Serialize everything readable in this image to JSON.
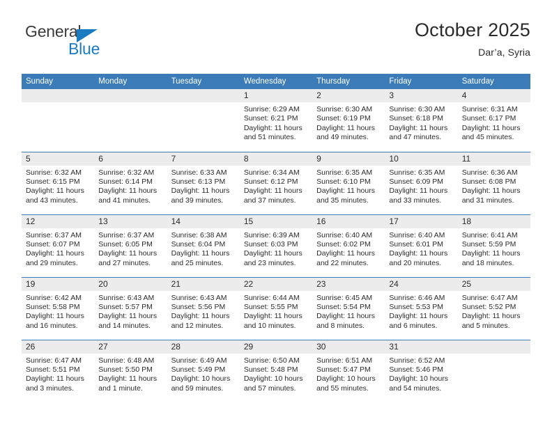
{
  "brand": {
    "name_top": "General",
    "name_bottom": "Blue"
  },
  "header": {
    "title": "October 2025",
    "location": "Dar’a, Syria"
  },
  "weekday_headers": [
    "Sunday",
    "Monday",
    "Tuesday",
    "Wednesday",
    "Thursday",
    "Friday",
    "Saturday"
  ],
  "labels": {
    "sunrise_prefix": "Sunrise: ",
    "sunset_prefix": "Sunset: ",
    "daylight_prefix": "Daylight: "
  },
  "colors": {
    "header_blue": "#3b7cb8",
    "daynum_gray": "#ececec",
    "brand_blue": "#1b7bc0",
    "text": "#2b2b2b"
  },
  "weeks": [
    [
      {
        "day": "",
        "empty": true
      },
      {
        "day": "",
        "empty": true
      },
      {
        "day": "",
        "empty": true
      },
      {
        "day": "1",
        "sunrise": "Sunrise: 6:29 AM",
        "sunset": "Sunset: 6:21 PM",
        "daylight_l1": "Daylight: 11 hours",
        "daylight_l2": "and 51 minutes."
      },
      {
        "day": "2",
        "sunrise": "Sunrise: 6:30 AM",
        "sunset": "Sunset: 6:19 PM",
        "daylight_l1": "Daylight: 11 hours",
        "daylight_l2": "and 49 minutes."
      },
      {
        "day": "3",
        "sunrise": "Sunrise: 6:30 AM",
        "sunset": "Sunset: 6:18 PM",
        "daylight_l1": "Daylight: 11 hours",
        "daylight_l2": "and 47 minutes."
      },
      {
        "day": "4",
        "sunrise": "Sunrise: 6:31 AM",
        "sunset": "Sunset: 6:17 PM",
        "daylight_l1": "Daylight: 11 hours",
        "daylight_l2": "and 45 minutes."
      }
    ],
    [
      {
        "day": "5",
        "sunrise": "Sunrise: 6:32 AM",
        "sunset": "Sunset: 6:15 PM",
        "daylight_l1": "Daylight: 11 hours",
        "daylight_l2": "and 43 minutes."
      },
      {
        "day": "6",
        "sunrise": "Sunrise: 6:32 AM",
        "sunset": "Sunset: 6:14 PM",
        "daylight_l1": "Daylight: 11 hours",
        "daylight_l2": "and 41 minutes."
      },
      {
        "day": "7",
        "sunrise": "Sunrise: 6:33 AM",
        "sunset": "Sunset: 6:13 PM",
        "daylight_l1": "Daylight: 11 hours",
        "daylight_l2": "and 39 minutes."
      },
      {
        "day": "8",
        "sunrise": "Sunrise: 6:34 AM",
        "sunset": "Sunset: 6:12 PM",
        "daylight_l1": "Daylight: 11 hours",
        "daylight_l2": "and 37 minutes."
      },
      {
        "day": "9",
        "sunrise": "Sunrise: 6:35 AM",
        "sunset": "Sunset: 6:10 PM",
        "daylight_l1": "Daylight: 11 hours",
        "daylight_l2": "and 35 minutes."
      },
      {
        "day": "10",
        "sunrise": "Sunrise: 6:35 AM",
        "sunset": "Sunset: 6:09 PM",
        "daylight_l1": "Daylight: 11 hours",
        "daylight_l2": "and 33 minutes."
      },
      {
        "day": "11",
        "sunrise": "Sunrise: 6:36 AM",
        "sunset": "Sunset: 6:08 PM",
        "daylight_l1": "Daylight: 11 hours",
        "daylight_l2": "and 31 minutes."
      }
    ],
    [
      {
        "day": "12",
        "sunrise": "Sunrise: 6:37 AM",
        "sunset": "Sunset: 6:07 PM",
        "daylight_l1": "Daylight: 11 hours",
        "daylight_l2": "and 29 minutes."
      },
      {
        "day": "13",
        "sunrise": "Sunrise: 6:37 AM",
        "sunset": "Sunset: 6:05 PM",
        "daylight_l1": "Daylight: 11 hours",
        "daylight_l2": "and 27 minutes."
      },
      {
        "day": "14",
        "sunrise": "Sunrise: 6:38 AM",
        "sunset": "Sunset: 6:04 PM",
        "daylight_l1": "Daylight: 11 hours",
        "daylight_l2": "and 25 minutes."
      },
      {
        "day": "15",
        "sunrise": "Sunrise: 6:39 AM",
        "sunset": "Sunset: 6:03 PM",
        "daylight_l1": "Daylight: 11 hours",
        "daylight_l2": "and 23 minutes."
      },
      {
        "day": "16",
        "sunrise": "Sunrise: 6:40 AM",
        "sunset": "Sunset: 6:02 PM",
        "daylight_l1": "Daylight: 11 hours",
        "daylight_l2": "and 22 minutes."
      },
      {
        "day": "17",
        "sunrise": "Sunrise: 6:40 AM",
        "sunset": "Sunset: 6:01 PM",
        "daylight_l1": "Daylight: 11 hours",
        "daylight_l2": "and 20 minutes."
      },
      {
        "day": "18",
        "sunrise": "Sunrise: 6:41 AM",
        "sunset": "Sunset: 5:59 PM",
        "daylight_l1": "Daylight: 11 hours",
        "daylight_l2": "and 18 minutes."
      }
    ],
    [
      {
        "day": "19",
        "sunrise": "Sunrise: 6:42 AM",
        "sunset": "Sunset: 5:58 PM",
        "daylight_l1": "Daylight: 11 hours",
        "daylight_l2": "and 16 minutes."
      },
      {
        "day": "20",
        "sunrise": "Sunrise: 6:43 AM",
        "sunset": "Sunset: 5:57 PM",
        "daylight_l1": "Daylight: 11 hours",
        "daylight_l2": "and 14 minutes."
      },
      {
        "day": "21",
        "sunrise": "Sunrise: 6:43 AM",
        "sunset": "Sunset: 5:56 PM",
        "daylight_l1": "Daylight: 11 hours",
        "daylight_l2": "and 12 minutes."
      },
      {
        "day": "22",
        "sunrise": "Sunrise: 6:44 AM",
        "sunset": "Sunset: 5:55 PM",
        "daylight_l1": "Daylight: 11 hours",
        "daylight_l2": "and 10 minutes."
      },
      {
        "day": "23",
        "sunrise": "Sunrise: 6:45 AM",
        "sunset": "Sunset: 5:54 PM",
        "daylight_l1": "Daylight: 11 hours",
        "daylight_l2": "and 8 minutes."
      },
      {
        "day": "24",
        "sunrise": "Sunrise: 6:46 AM",
        "sunset": "Sunset: 5:53 PM",
        "daylight_l1": "Daylight: 11 hours",
        "daylight_l2": "and 6 minutes."
      },
      {
        "day": "25",
        "sunrise": "Sunrise: 6:47 AM",
        "sunset": "Sunset: 5:52 PM",
        "daylight_l1": "Daylight: 11 hours",
        "daylight_l2": "and 5 minutes."
      }
    ],
    [
      {
        "day": "26",
        "sunrise": "Sunrise: 6:47 AM",
        "sunset": "Sunset: 5:51 PM",
        "daylight_l1": "Daylight: 11 hours",
        "daylight_l2": "and 3 minutes."
      },
      {
        "day": "27",
        "sunrise": "Sunrise: 6:48 AM",
        "sunset": "Sunset: 5:50 PM",
        "daylight_l1": "Daylight: 11 hours",
        "daylight_l2": "and 1 minute."
      },
      {
        "day": "28",
        "sunrise": "Sunrise: 6:49 AM",
        "sunset": "Sunset: 5:49 PM",
        "daylight_l1": "Daylight: 10 hours",
        "daylight_l2": "and 59 minutes."
      },
      {
        "day": "29",
        "sunrise": "Sunrise: 6:50 AM",
        "sunset": "Sunset: 5:48 PM",
        "daylight_l1": "Daylight: 10 hours",
        "daylight_l2": "and 57 minutes."
      },
      {
        "day": "30",
        "sunrise": "Sunrise: 6:51 AM",
        "sunset": "Sunset: 5:47 PM",
        "daylight_l1": "Daylight: 10 hours",
        "daylight_l2": "and 55 minutes."
      },
      {
        "day": "31",
        "sunrise": "Sunrise: 6:52 AM",
        "sunset": "Sunset: 5:46 PM",
        "daylight_l1": "Daylight: 10 hours",
        "daylight_l2": "and 54 minutes."
      },
      {
        "day": "",
        "empty": true
      }
    ]
  ]
}
